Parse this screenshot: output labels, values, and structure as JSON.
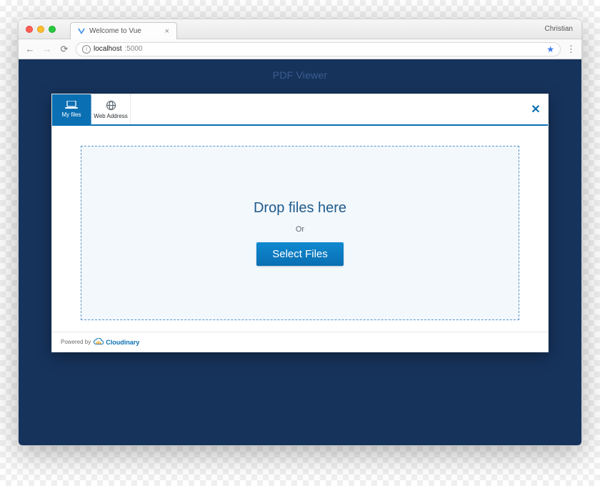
{
  "browser": {
    "tab_title": "Welcome to Vue",
    "profile_name": "Christian",
    "url_host": "localhost",
    "url_port": ":5000"
  },
  "page": {
    "title": "PDF Viewer"
  },
  "widget": {
    "tabs": {
      "my_files": "My files",
      "web_address": "Web Address"
    },
    "drop_title": "Drop files here",
    "or_text": "Or",
    "select_button": "Select Files",
    "powered_by": "Powered by",
    "brand": "Cloudinary"
  }
}
